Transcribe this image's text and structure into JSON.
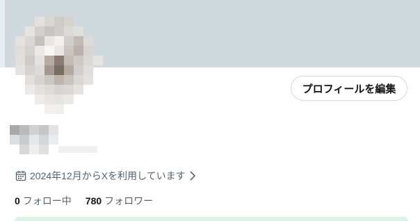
{
  "colors": {
    "banner": "#cfd9de",
    "secondary_text": "#536471",
    "primary_text": "#0f1419",
    "border": "#cfd9de",
    "notice_bg": "#d7f4e6"
  },
  "profile": {
    "edit_button_label": "プロフィールを編集",
    "joined_text": "2024年12月からXを利用しています",
    "joined_icon": "calendar-icon",
    "joined_chevron_icon": "chevron-right-icon"
  },
  "stats": {
    "following_count": "0",
    "following_label": "フォロー中",
    "followers_count": "780",
    "followers_label": "フォロワー"
  }
}
